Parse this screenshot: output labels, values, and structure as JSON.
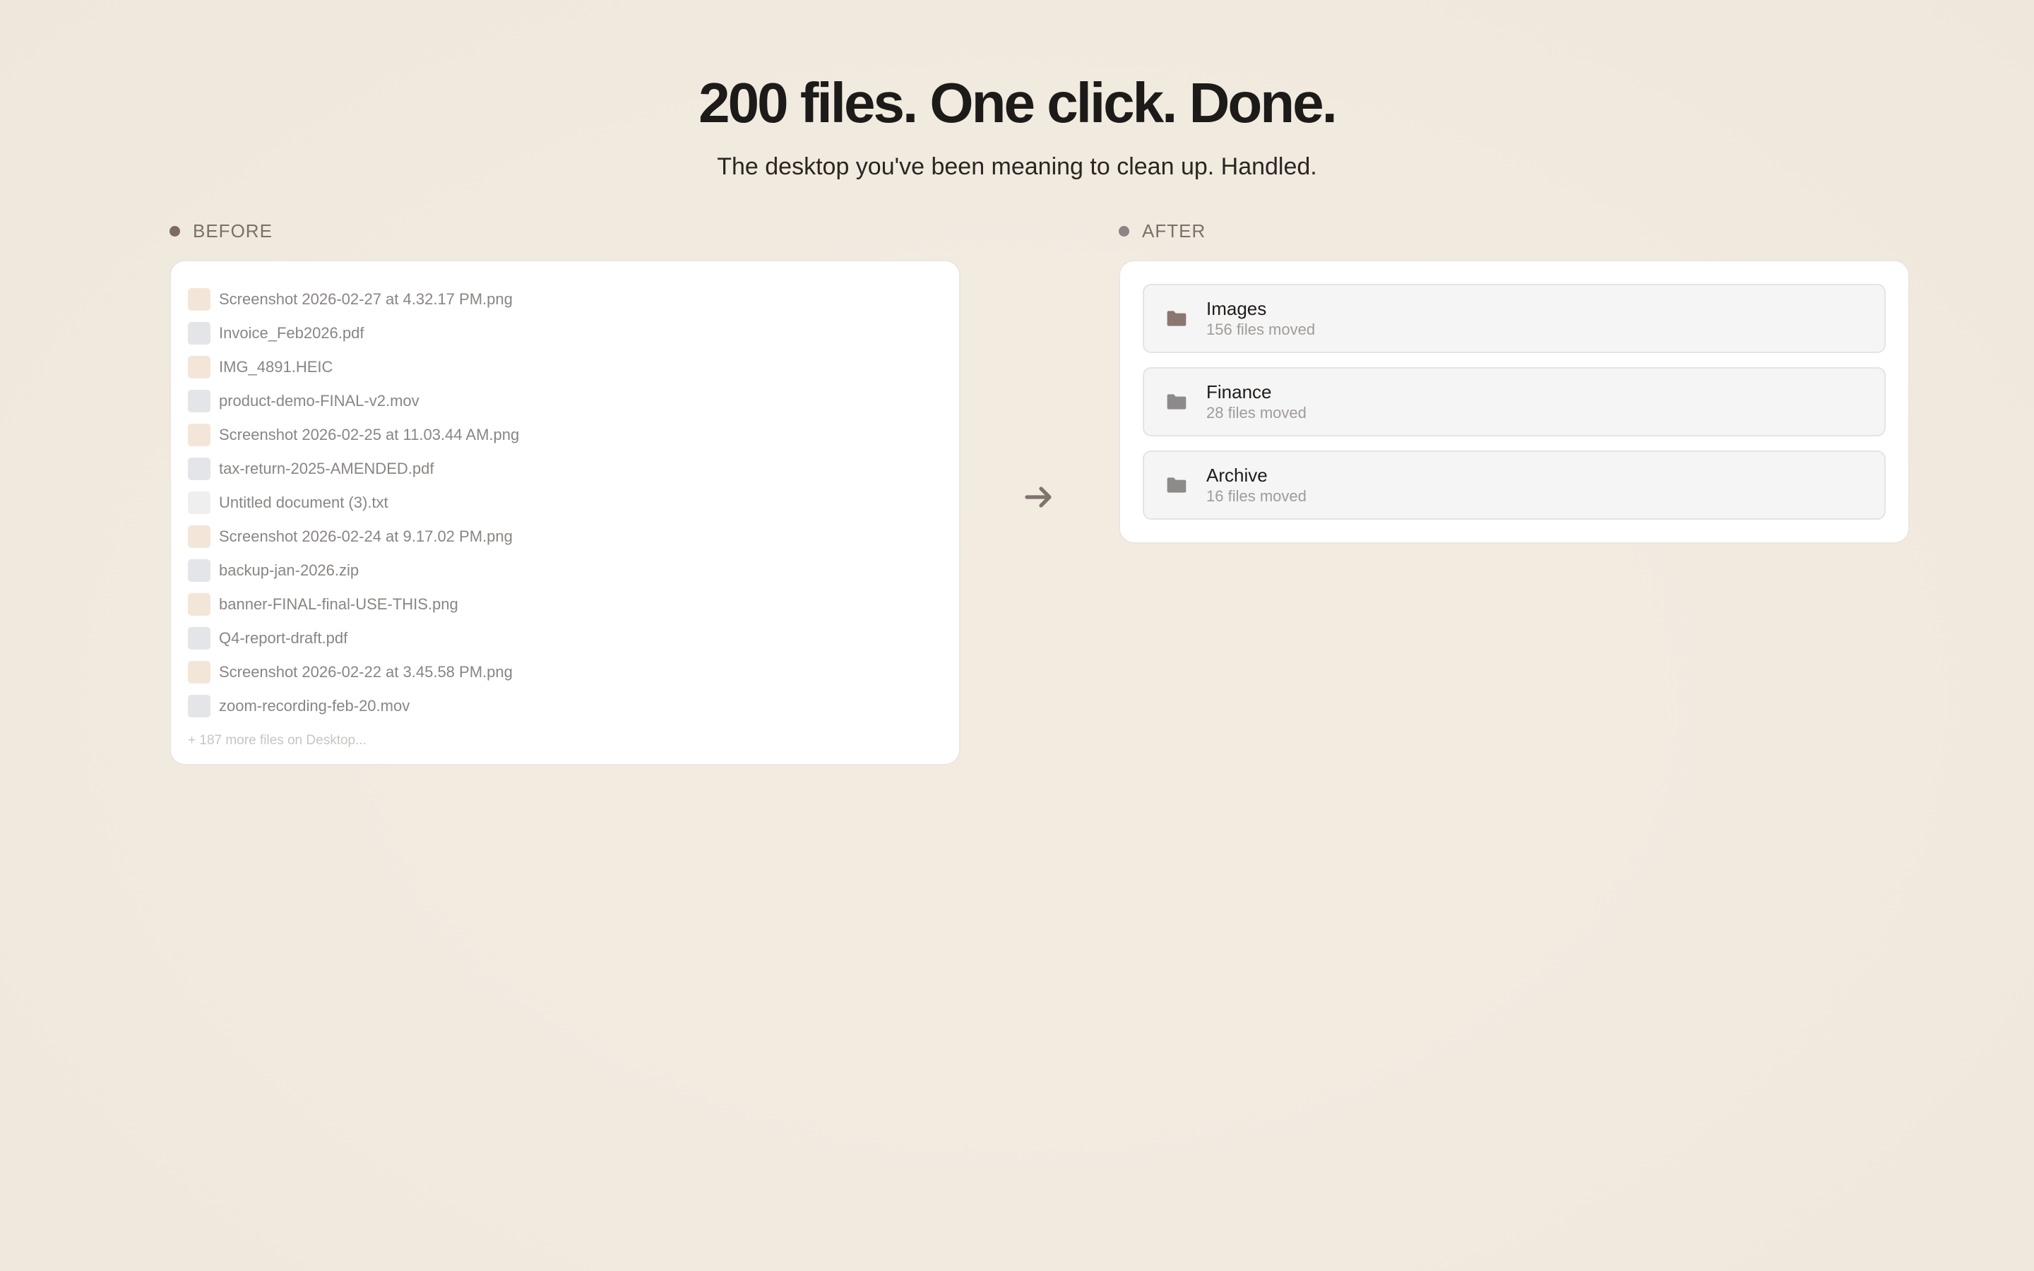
{
  "hero": {
    "title": "200 files. One click. Done.",
    "subtitle": "The desktop you've been meaning to clean up. Handled."
  },
  "before": {
    "label": "BEFORE",
    "files": [
      {
        "name": "Screenshot 2026-02-27 at 4.32.17 PM.png",
        "kind": "img"
      },
      {
        "name": "Invoice_Feb2026.pdf",
        "kind": "doc"
      },
      {
        "name": "IMG_4891.HEIC",
        "kind": "img"
      },
      {
        "name": "product-demo-FINAL-v2.mov",
        "kind": "doc"
      },
      {
        "name": "Screenshot 2026-02-25 at 11.03.44 AM.png",
        "kind": "img"
      },
      {
        "name": "tax-return-2025-AMENDED.pdf",
        "kind": "doc"
      },
      {
        "name": "Untitled document (3).txt",
        "kind": "txt"
      },
      {
        "name": "Screenshot 2026-02-24 at 9.17.02 PM.png",
        "kind": "img"
      },
      {
        "name": "backup-jan-2026.zip",
        "kind": "doc"
      },
      {
        "name": "banner-FINAL-final-USE-THIS.png",
        "kind": "img"
      },
      {
        "name": "Q4-report-draft.pdf",
        "kind": "doc"
      },
      {
        "name": "Screenshot 2026-02-22 at 3.45.58 PM.png",
        "kind": "img"
      },
      {
        "name": "zoom-recording-feb-20.mov",
        "kind": "doc"
      }
    ],
    "more": "+ 187 more files on Desktop..."
  },
  "arrow_icon": "arrow-right-icon",
  "after": {
    "label": "AFTER",
    "folders": [
      {
        "name": "Images",
        "count": "156 files moved",
        "icon_color": "#8a7770"
      },
      {
        "name": "Finance",
        "count": "28 files moved",
        "icon_color": "#8d8b8a"
      },
      {
        "name": "Archive",
        "count": "16 files moved",
        "icon_color": "#8d8b8a"
      }
    ]
  },
  "colors": {
    "background": "#f2ebe0",
    "card": "#ffffff",
    "before_dot": "#7c6a63",
    "after_dot": "#8b8684",
    "image_file_icon": "#f3e6d8",
    "doc_file_icon": "#e3e5e9",
    "txt_file_icon": "#efefef"
  }
}
